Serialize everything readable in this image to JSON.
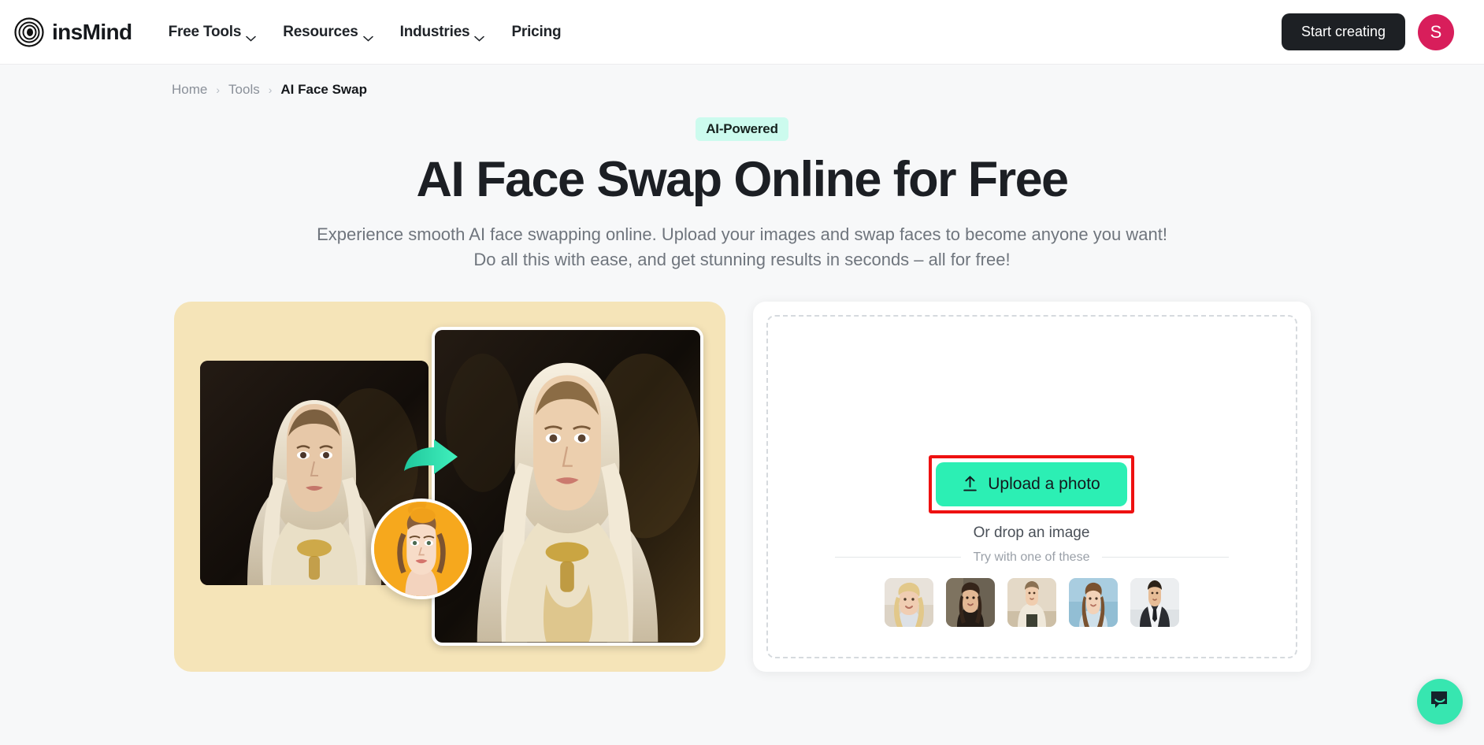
{
  "header": {
    "brand_name": "insMind",
    "logo_icon": "spiral-target-logo",
    "nav": [
      {
        "label": "Free Tools",
        "has_chevron": true
      },
      {
        "label": "Resources",
        "has_chevron": true
      },
      {
        "label": "Industries",
        "has_chevron": true
      },
      {
        "label": "Pricing",
        "has_chevron": false
      }
    ],
    "start_button": "Start creating",
    "avatar_initial": "S",
    "avatar_color": "#d81e5b"
  },
  "breadcrumb": {
    "home": "Home",
    "sep1": "›",
    "tools": "Tools",
    "sep2": "›",
    "current": "AI Face Swap"
  },
  "hero": {
    "badge": "AI-Powered",
    "title": "AI Face Swap Online for Free",
    "subtitle_line1": "Experience smooth AI face swapping online. Upload your images and swap faces to become anyone you want!",
    "subtitle_line2": "Do all this with ease, and get stunning results in seconds – all for free!"
  },
  "demo": {
    "panel_bg": "#f5e4b8",
    "before_alt": "before-portrait-girl-in-lace-veil",
    "after_alt": "after-portrait-face-swapped",
    "arrow_icon": "swap-arrow-icon",
    "arrow_color": "#2cd8a8",
    "face_source_alt": "source-face-circular-thumbnail",
    "face_source_bg": "#f5a623"
  },
  "upload": {
    "button_label": "Upload a photo",
    "button_icon": "upload-arrow-icon",
    "button_color": "#2cefb4",
    "drop_hint": "Or drop an image",
    "annotation_color": "#ee1111",
    "try_label": "Try with one of these",
    "samples": [
      {
        "name": "sample-blonde-woman-smiling",
        "c1": "#e8e2da",
        "c2": "#cfc3b0",
        "skin": "#f0cdb2",
        "hair": "#e2c88a",
        "cloth": "#dde1e6"
      },
      {
        "name": "sample-woman-dark-dress",
        "c1": "#6b6253",
        "c2": "#2e2721",
        "skin": "#e3b894",
        "hair": "#35251a",
        "cloth": "#241c16"
      },
      {
        "name": "sample-man-cream-hoodie",
        "c1": "#e4d9c7",
        "c2": "#cdbfa6",
        "skin": "#f0cdae",
        "hair": "#8a7153",
        "cloth": "#efe8da"
      },
      {
        "name": "sample-woman-blue-shirt",
        "c1": "#a9cde0",
        "c2": "#7fb2cb",
        "skin": "#f2d2b8",
        "hair": "#7a5230",
        "cloth": "#cfe0ea"
      },
      {
        "name": "sample-man-in-suit",
        "c1": "#eceef0",
        "c2": "#d6dade",
        "skin": "#e7bd97",
        "hair": "#2b2118",
        "cloth": "#2a2c31"
      }
    ]
  },
  "chat": {
    "icon": "chat-bubble-smile-icon",
    "color": "#37e6b0"
  }
}
